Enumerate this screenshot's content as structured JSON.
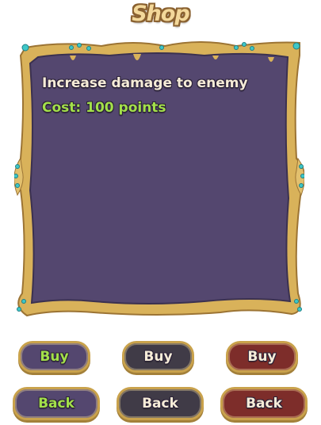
{
  "shop": {
    "title": "Shop",
    "description": "Increase damage to enemy",
    "cost": "Cost: 100 points"
  },
  "buttons": {
    "buy_purple": "Buy",
    "buy_dark": "Buy",
    "buy_red": "Buy",
    "back_purple": "Back",
    "back_dark": "Back",
    "back_red": "Back"
  },
  "colors": {
    "panel": "#54476f",
    "frame_gold": "#d9b25a",
    "gem": "#3ec8c8",
    "dark_button": "#403b47",
    "red_button": "#7d2d2a",
    "accent_green": "#a3e04a"
  }
}
